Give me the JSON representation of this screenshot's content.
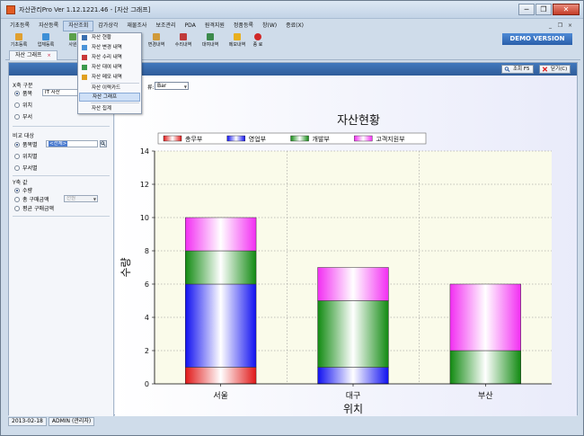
{
  "window": {
    "title": "자산관리Pro Ver 1.12.1221.46 - [자산 그래프]",
    "buttons": [
      "─",
      "❐",
      "✕"
    ]
  },
  "menu": [
    {
      "label": "기초등록"
    },
    {
      "label": "자산등록"
    },
    {
      "label": "자산조회"
    },
    {
      "label": "감가상각"
    },
    {
      "label": "재물조사"
    },
    {
      "label": "보조관리"
    },
    {
      "label": "PDA"
    },
    {
      "label": "원격지원"
    },
    {
      "label": "정품등록"
    },
    {
      "label": "창(W)"
    },
    {
      "label": "종료(X)"
    }
  ],
  "mdi_buttons": [
    "_",
    "❐",
    "×"
  ],
  "demo_badge": "DEMO VERSION",
  "toolbar": [
    {
      "label": "기초등록",
      "color": "#e0a030"
    },
    {
      "label": "업체등록",
      "color": "#3d8fd6"
    },
    {
      "label": "사원",
      "color": "#5aa04a"
    },
    {
      "label": "변경내역",
      "color": "#d09a3a"
    },
    {
      "label": "수리내역",
      "color": "#c03a3a"
    },
    {
      "label": "대여내역",
      "color": "#3c8a4c"
    },
    {
      "label": "메모내역",
      "color": "#e8b020"
    },
    {
      "label": "종 료",
      "color": "#d02828"
    }
  ],
  "tab": {
    "label": "자산 그래프",
    "close": "×"
  },
  "actions": {
    "search": "조회 F5",
    "close": "닫기(C)"
  },
  "dropdown_items": [
    {
      "label": "자산 현황",
      "color": "#3a6fb0"
    },
    {
      "label": "자산 변경 내역",
      "color": "#4b93d8"
    },
    {
      "label": "자산 수리 내역",
      "color": "#c83838"
    },
    {
      "label": "자산 대여 내역",
      "color": "#3c9a4c"
    },
    {
      "label": "자산 메모 내역",
      "color": "#e0a020"
    },
    {
      "label": "자산 이력카드",
      "color": ""
    },
    {
      "label": "자산 그래프",
      "color": ""
    },
    {
      "label": "자산 집계",
      "color": ""
    }
  ],
  "left": {
    "x_axis_title": "X축 구분",
    "x_options": [
      "품목",
      "위치",
      "부서"
    ],
    "item_value": "IT 자산",
    "compare_title": "비교 대상",
    "compare_options": [
      "품목별",
      "위치별",
      "부서별"
    ],
    "compare_value": "<전체>",
    "y_axis_title": "Y축 값",
    "y_options": [
      "수량",
      "총 구매금액",
      "평균 구매금액"
    ],
    "unit_value": "천원"
  },
  "chart_type": {
    "label": "류:",
    "value": "Bar"
  },
  "status": {
    "date": "2013-02-18",
    "user": "ADMIN (관리자)"
  },
  "chart_data": {
    "type": "bar",
    "stacked": true,
    "title": "자산현황",
    "xlabel": "위치",
    "ylabel": "수량",
    "categories": [
      "서울",
      "대구",
      "부산"
    ],
    "ylim": [
      0,
      14
    ],
    "yticks": [
      0,
      2,
      4,
      6,
      8,
      10,
      12,
      14
    ],
    "grid": true,
    "legend_position": "top",
    "series": [
      {
        "name": "총무부",
        "values": [
          1,
          0,
          0
        ],
        "color": "#e01818"
      },
      {
        "name": "영업부",
        "values": [
          5,
          1,
          0
        ],
        "color": "#1010f0"
      },
      {
        "name": "개발부",
        "values": [
          2,
          4,
          2
        ],
        "color": "#118a11"
      },
      {
        "name": "고객지원부",
        "values": [
          2,
          2,
          4
        ],
        "color": "#f22ef2"
      }
    ]
  }
}
